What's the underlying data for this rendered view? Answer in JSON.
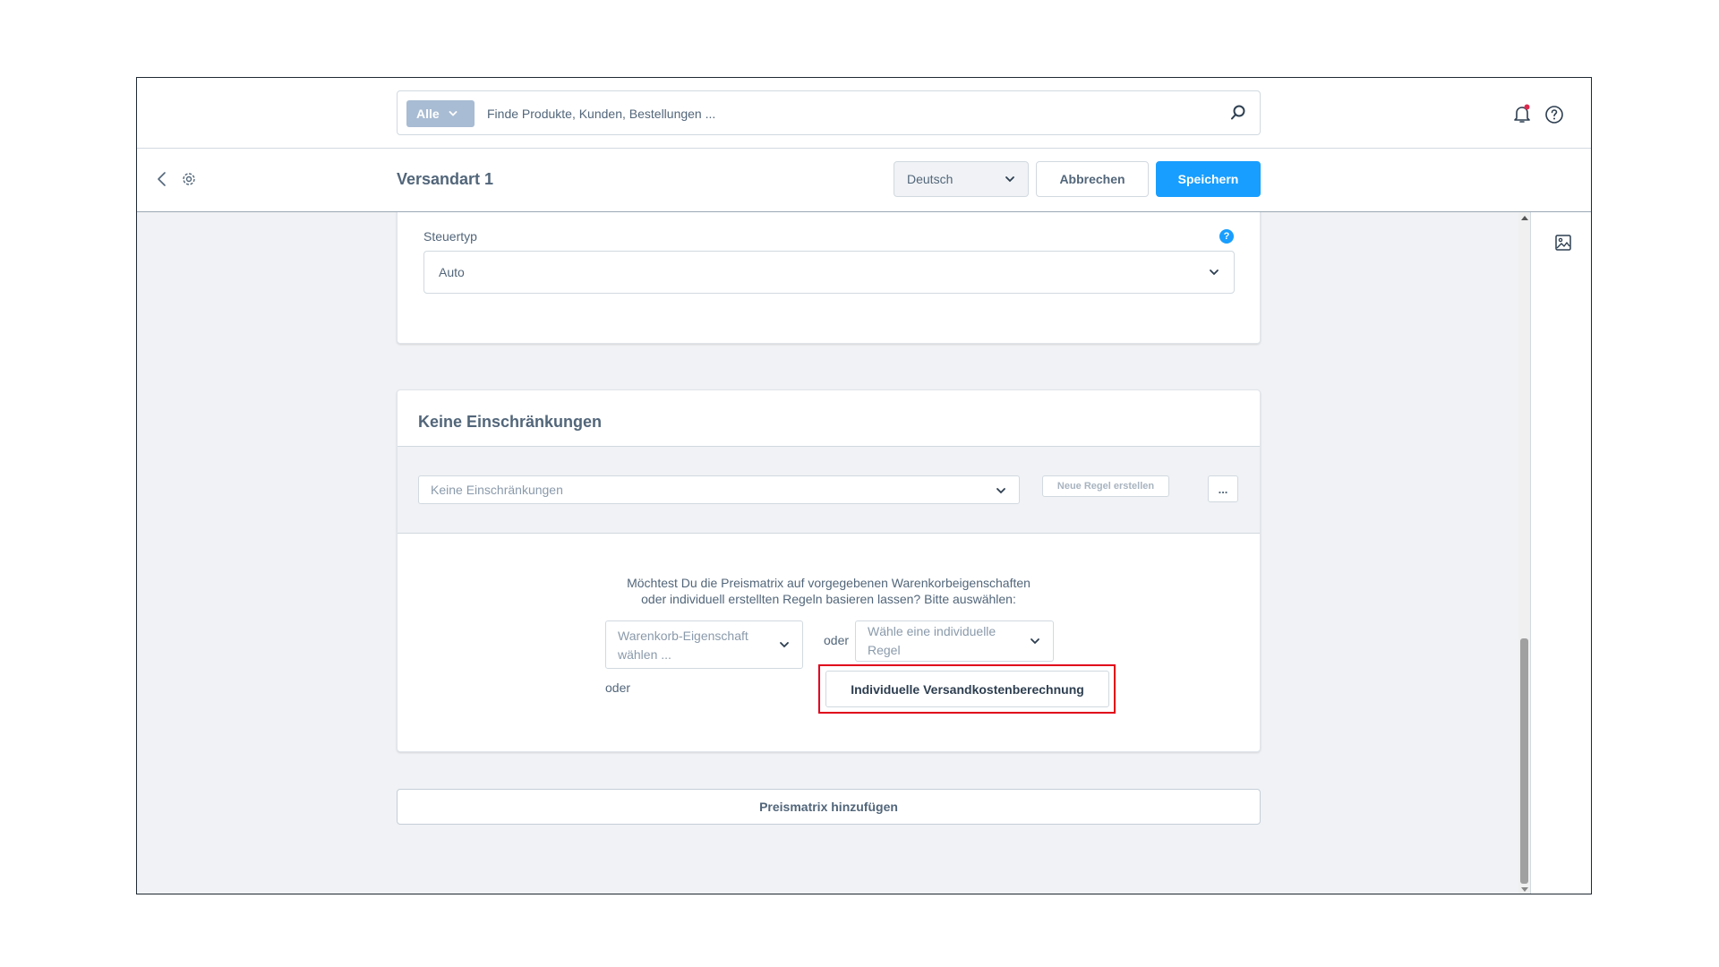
{
  "header": {
    "search_type": "Alle",
    "search_placeholder": "Finde Produkte, Kunden, Bestellungen ..."
  },
  "actionbar": {
    "title": "Versandart 1",
    "language": "Deutsch",
    "cancel_label": "Abbrechen",
    "save_label": "Speichern"
  },
  "tax_card": {
    "label": "Steuertyp",
    "help_badge": "?",
    "value": "Auto"
  },
  "rules_card": {
    "title": "Keine Einschränkungen",
    "rule_select": "Keine Einschränkungen",
    "new_rule_label": "Neue Regel erstellen",
    "more_label": "...",
    "question_line1": "Möchtest Du die Preismatrix auf vorgegebenen Warenkorbeigenschaften",
    "question_line2": "oder individuell erstellten Regeln basieren lassen? Bitte auswählen:",
    "property_placeholder": "Warenkorb-Eigenschaft wählen ...",
    "or_label": "oder",
    "rule_placeholder": "Wähle eine individuelle Regel",
    "or_label_2": "oder",
    "custom_calc_label": "Individuelle Versandkostenberechnung"
  },
  "add_matrix_label": "Preismatrix hinzufügen",
  "colors": {
    "primary": "#189eff",
    "highlight": "#e0001a",
    "notification": "#de294c"
  },
  "icons": [
    "search-icon",
    "bell-icon",
    "help-icon",
    "back-icon",
    "gear-icon",
    "chevron-down-icon",
    "image-icon"
  ]
}
